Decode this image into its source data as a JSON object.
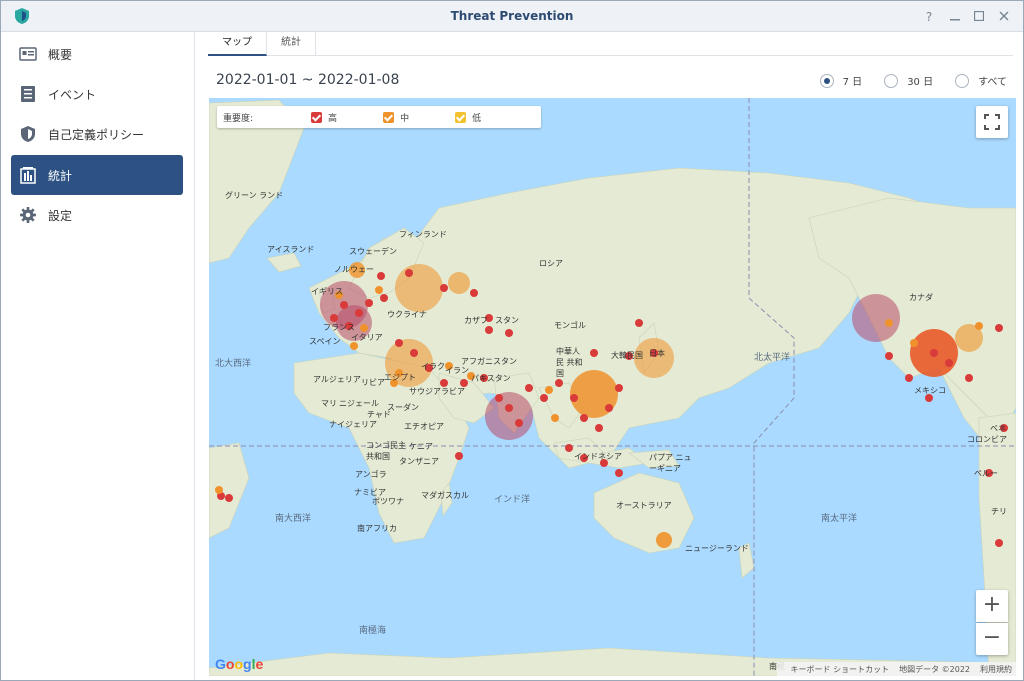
{
  "window": {
    "title": "Threat Prevention",
    "help_label": "?"
  },
  "sidebar": {
    "items": [
      {
        "label": "概要",
        "icon": "overview-card-icon"
      },
      {
        "label": "イベント",
        "icon": "event-list-icon"
      },
      {
        "label": "自己定義ポリシー",
        "icon": "shield-icon"
      },
      {
        "label": "統計",
        "icon": "statistics-building-icon",
        "active": true
      },
      {
        "label": "設定",
        "icon": "gear-icon"
      }
    ]
  },
  "tabs": [
    {
      "label": "マップ",
      "active": true
    },
    {
      "label": "統計",
      "active": false
    }
  ],
  "date_range": "2022-01-01 ~ 2022-01-08",
  "period_options": [
    {
      "label": "7 日",
      "selected": true
    },
    {
      "label": "30 日",
      "selected": false
    },
    {
      "label": "すべて",
      "selected": false
    }
  ],
  "legend": {
    "title": "重要度:",
    "levels": [
      {
        "label": "高",
        "color": "#d93a3a"
      },
      {
        "label": "中",
        "color": "#f0922b"
      },
      {
        "label": "低",
        "color": "#f2c230"
      }
    ]
  },
  "map": {
    "ocean_color": "#aadaff",
    "land_color": "#e7ecd8",
    "labels": [
      "グリーン ランド",
      "アイスランド",
      "フィンランド",
      "スウェーデン",
      "ノルウェー",
      "イギリス",
      "フランス",
      "イタリア",
      "スペイン",
      "ウクライナ",
      "ロシア",
      "カザフ",
      "スタン",
      "モンゴル",
      "中華人民 共和国",
      "大韓民国",
      "日本",
      "アフガニスタン",
      "イラン",
      "パキスタン",
      "イラク",
      "サウジアラビア",
      "エジプト",
      "リビア",
      "アルジェリア",
      "マリ",
      "ニジェール",
      "チャド",
      "スーダン",
      "ナイジェリア",
      "エチオピア",
      "コンゴ民主 共和国",
      "ケニア",
      "タンザニア",
      "アンゴラ",
      "ナミビア",
      "ボツワナ",
      "南アフリカ",
      "マダガスカル",
      "インド洋",
      "インドネシア",
      "パプア ニューギニア",
      "オーストラリア",
      "ニュージーランド",
      "北大西洋",
      "北太平洋",
      "南大西洋",
      "南太平洋",
      "南極海",
      "南極",
      "カナダ",
      "メキシコ",
      "ベネ",
      "コロンビア",
      "ペルー",
      "チリ"
    ],
    "fullscreen_icon": "fullscreen-icon",
    "zoom_in": "+",
    "zoom_out": "−",
    "logo": "Google",
    "attribution": [
      "キーボード ショートカット",
      "地図データ ©2022",
      "利用規約"
    ]
  }
}
